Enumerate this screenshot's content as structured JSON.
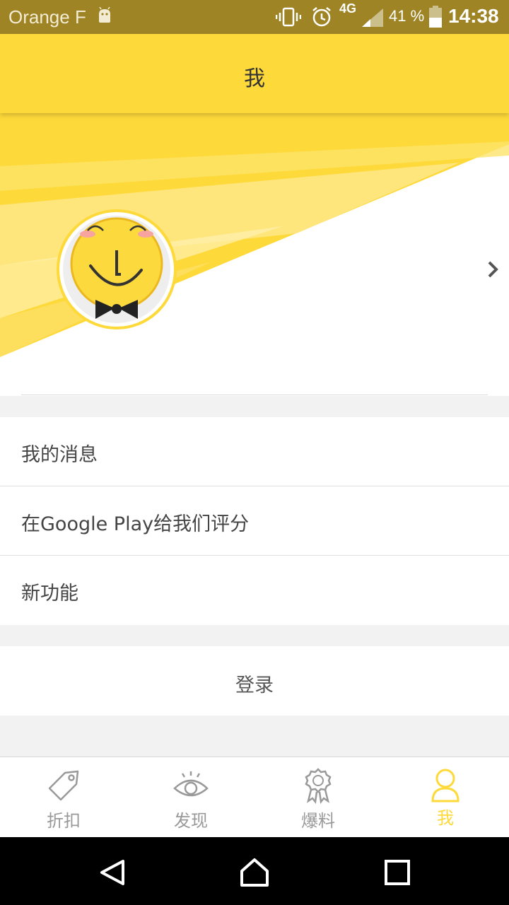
{
  "status_bar": {
    "carrier": "Orange F",
    "network": "4G",
    "battery_percent": "41 %",
    "time": "14:38",
    "icons": [
      "android-icon",
      "vibrate-icon",
      "alarm-icon",
      "signal-icon",
      "battery-icon"
    ]
  },
  "app_bar": {
    "title": "我"
  },
  "colors": {
    "accent": "#fed93a",
    "status_bar": "#9e8425",
    "tab_inactive": "#999999"
  },
  "menu": {
    "items": [
      {
        "label": "我的消息"
      },
      {
        "label": "在Google Play给我们评分"
      },
      {
        "label": "新功能"
      }
    ]
  },
  "login": {
    "label": "登录"
  },
  "tabs": [
    {
      "label": "折扣",
      "icon": "price-tag-icon",
      "active": false
    },
    {
      "label": "发现",
      "icon": "eye-icon",
      "active": false
    },
    {
      "label": "爆料",
      "icon": "award-badge-icon",
      "active": false
    },
    {
      "label": "我",
      "icon": "person-icon",
      "active": true
    }
  ],
  "nav_bar": {
    "icons": [
      "back-icon",
      "home-icon",
      "recents-icon"
    ]
  }
}
